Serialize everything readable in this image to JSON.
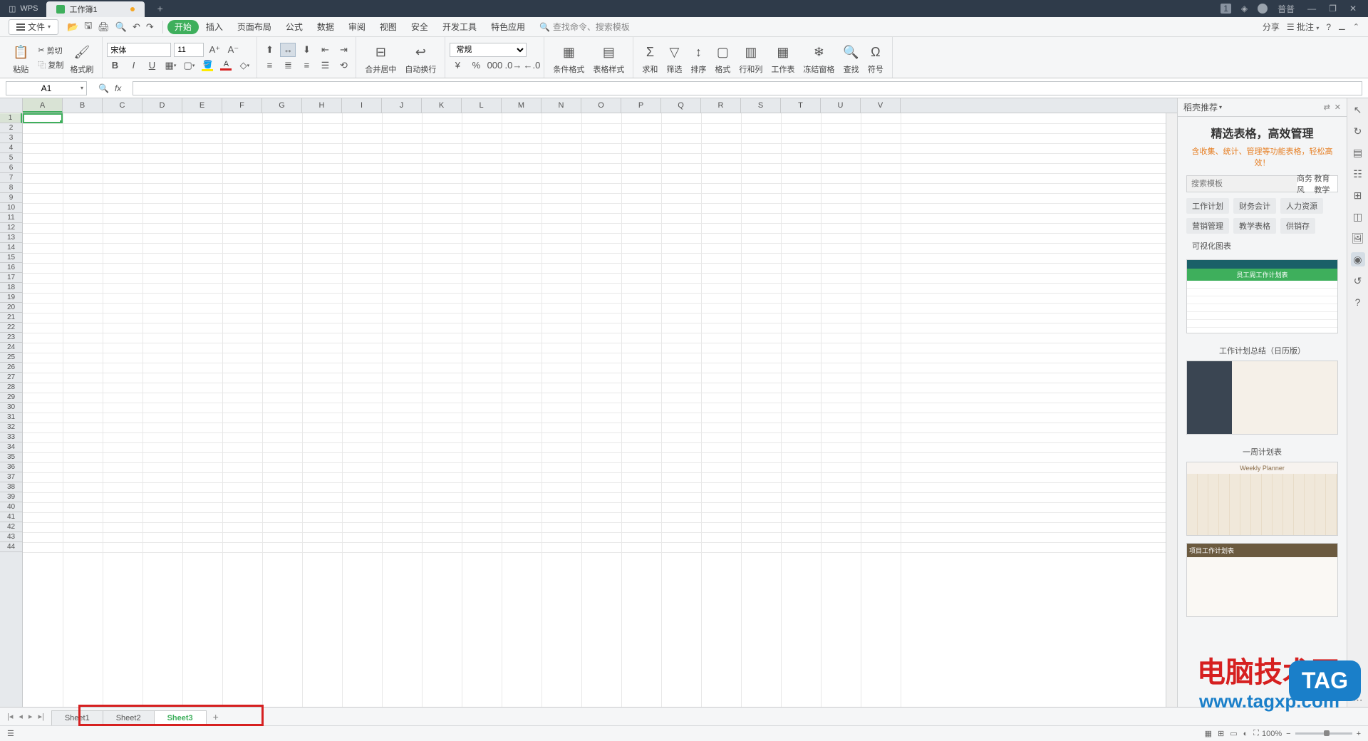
{
  "titlebar": {
    "app": "WPS",
    "tab_name": "工作簿1",
    "badge": "1",
    "user": "普普"
  },
  "menubar": {
    "file": "文件",
    "items": [
      "开始",
      "插入",
      "页面布局",
      "公式",
      "数据",
      "审阅",
      "视图",
      "安全",
      "开发工具",
      "特色应用"
    ],
    "active_index": 0,
    "search_placeholder": "查找命令、搜索模板",
    "share": "分享",
    "comment": "批注"
  },
  "ribbon": {
    "paste": "粘贴",
    "cut": "剪切",
    "copy": "复制",
    "format_painter": "格式刷",
    "font_name": "宋体",
    "font_size": "11",
    "merge": "合并居中",
    "wrap": "自动换行",
    "number_format": "常规",
    "cond_fmt": "条件格式",
    "table_style": "表格样式",
    "sum": "求和",
    "filter": "筛选",
    "sort": "排序",
    "format": "格式",
    "rowcol": "行和列",
    "sheet": "工作表",
    "freeze": "冻结窗格",
    "find": "查找",
    "symbol": "符号"
  },
  "fbar": {
    "cell_ref": "A1",
    "formula": ""
  },
  "columns": [
    "A",
    "B",
    "C",
    "D",
    "E",
    "F",
    "G",
    "H",
    "I",
    "J",
    "K",
    "L",
    "M",
    "N",
    "O",
    "P",
    "Q",
    "R",
    "S",
    "T",
    "U",
    "V"
  ],
  "rows_count": 44,
  "side_panel": {
    "header": "稻壳推荐",
    "title": "精选表格，高效管理",
    "subtitle": "含收集、统计、管理等功能表格，轻松高效！",
    "search_placeholder": "搜索模板",
    "search_cats": [
      "商务风",
      "教育教学"
    ],
    "tags": [
      "工作计划",
      "财务会计",
      "人力资源",
      "营销管理",
      "教学表格",
      "供销存",
      "可视化图表"
    ],
    "template_titles": [
      "员工周工作计划表",
      "工作计划总结（日历版）",
      "一周计划表",
      "Weekly Planner",
      "项目工作计划表"
    ]
  },
  "sheets": {
    "tabs": [
      "Sheet1",
      "Sheet2",
      "Sheet3"
    ],
    "active_index": 2
  },
  "status": {
    "zoom": "100%"
  },
  "watermark": {
    "line1": "电脑技术网",
    "line2": "www.tagxp.com",
    "tag": "TAG"
  }
}
